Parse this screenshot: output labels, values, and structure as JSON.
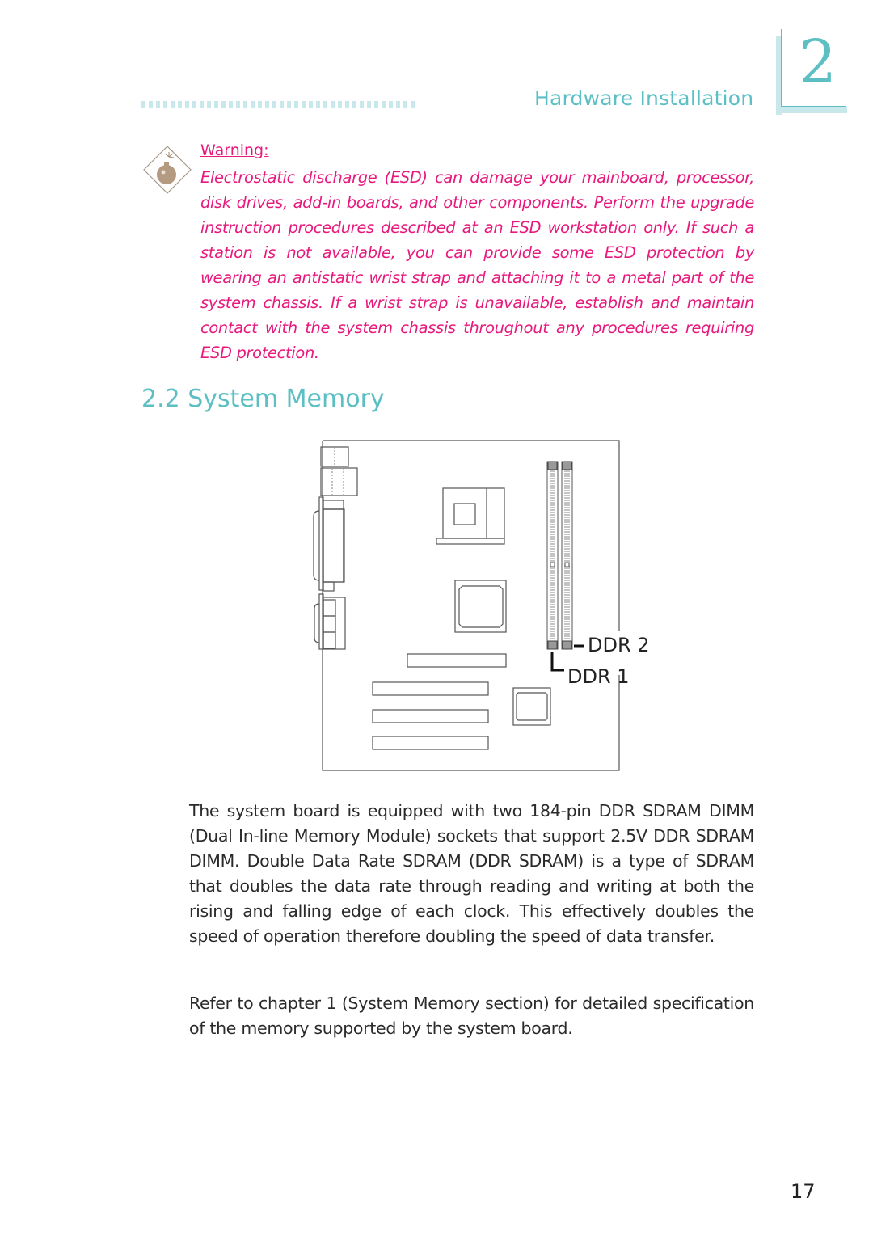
{
  "header": {
    "section_label": "Hardware Installation",
    "chapter_number": "2",
    "accent_color": "#5bbfc4"
  },
  "warning": {
    "icon": "bomb-icon",
    "title": "Warning:",
    "text": "Electrostatic discharge (ESD) can damage your mainboard, processor, disk drives, add-in boards, and other components. Perform the upgrade instruction procedures described at an ESD workstation only. If such a station is not available, you can provide some ESD protection by wearing an antistatic wrist strap and attaching it to a metal part of the system chassis. If a wrist strap is unavailable, establish and maintain contact with the system chassis throughout any procedures requiring ESD protection.",
    "color": "#e8197d"
  },
  "section": {
    "title": "2.2 System Memory"
  },
  "diagram": {
    "labels": {
      "ddr2": "DDR 2",
      "ddr1": "DDR 1"
    }
  },
  "body": {
    "paragraphs": [
      "The system board is equipped with two 184-pin DDR SDRAM DIMM (Dual In-line Memory Module) sockets that support 2.5V DDR SDRAM DIMM. Double Data Rate SDRAM (DDR SDRAM) is a type of SDRAM that doubles the data rate through reading and writing at both the rising and falling edge of each clock. This effectively doubles the speed of operation therefore doubling the speed of data transfer.",
      "Refer to chapter 1 (System Memory section) for detailed specification of the memory supported by the system board."
    ]
  },
  "footer": {
    "page_number": "17"
  }
}
